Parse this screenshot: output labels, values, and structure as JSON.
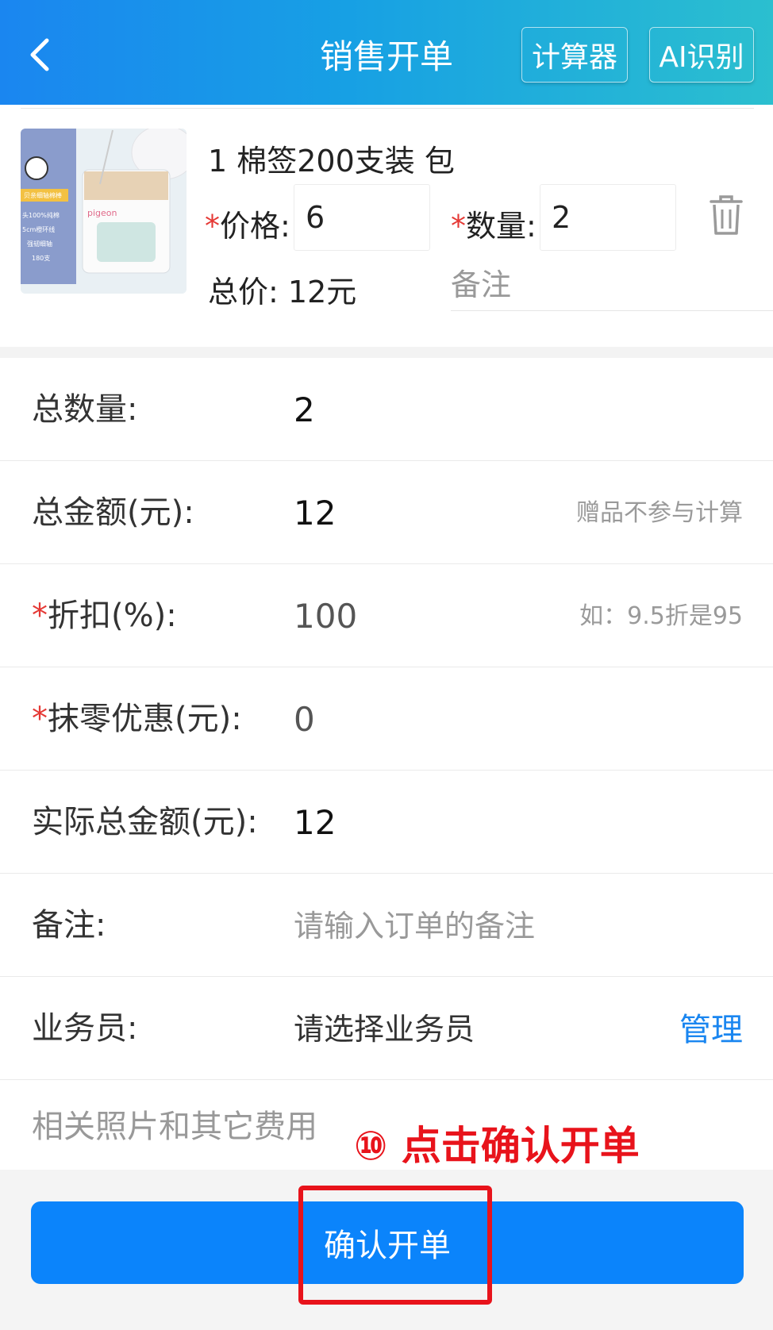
{
  "header": {
    "title": "销售开单",
    "calculator_label": "计算器",
    "ai_label": "AI识别",
    "gradient_start": "#1a86f0",
    "gradient_end": "#2bbfcf"
  },
  "product": {
    "name": "1 棉签200支装 包",
    "price_label": "价格:",
    "price_value": "6",
    "qty_label": "数量:",
    "qty_value": "2",
    "required_mark": "*",
    "total_label": "总价:",
    "total_value": "12元",
    "note_placeholder": "备注",
    "image_texts": [
      "贝亲细轴棉棒",
      "头100%纯棉",
      "5cm橙环线",
      "强韧细轴",
      "180支",
      "pigeon"
    ]
  },
  "form": {
    "total_qty": {
      "label": "总数量:",
      "value": "2"
    },
    "total_amount": {
      "label": "总金额(元):",
      "value": "12",
      "hint": "赠品不参与计算"
    },
    "discount": {
      "label": "折扣(%):",
      "value": "100",
      "hint": "如：9.5折是95"
    },
    "rounding": {
      "label": "抹零优惠(元):",
      "value": "0"
    },
    "actual_total": {
      "label": "实际总金额(元):",
      "value": "12"
    },
    "note": {
      "label": "备注:",
      "placeholder": "请输入订单的备注"
    },
    "salesperson": {
      "label": "业务员:",
      "placeholder": "请选择业务员",
      "manage_label": "管理"
    },
    "photos": {
      "label": "相关照片和其它费用"
    }
  },
  "annotation": {
    "text": "⑩ 点击确认开单",
    "color": "#e8131b"
  },
  "confirm_button": {
    "label": "确认开单",
    "color": "#0b84fb"
  }
}
